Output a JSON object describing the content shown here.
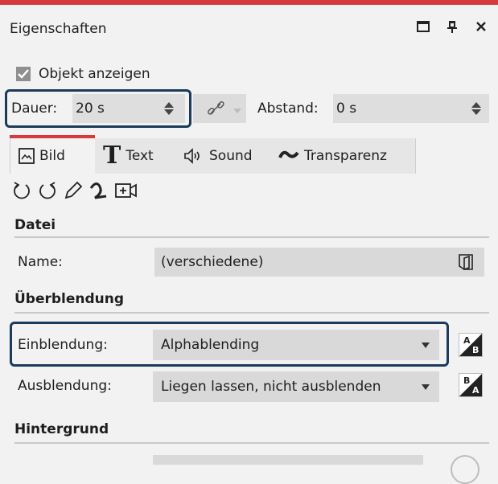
{
  "panel": {
    "title": "Eigenschaften"
  },
  "window_buttons": [
    "maximize-icon",
    "pin-icon",
    "close-icon"
  ],
  "show_object": {
    "label": "Objekt anzeigen",
    "checked": true
  },
  "duration": {
    "label": "Dauer:",
    "value": "20 s"
  },
  "spacing": {
    "label": "Abstand:",
    "value": "0 s"
  },
  "tabs": [
    {
      "label": "Bild",
      "icon": "image-icon",
      "active": true
    },
    {
      "label": "Text",
      "icon": "text-icon",
      "active": false
    },
    {
      "label": "Sound",
      "icon": "speaker-icon",
      "active": false
    },
    {
      "label": "Transparenz",
      "icon": "transparency-icon",
      "active": false
    }
  ],
  "tools": [
    "rotate-left-icon",
    "rotate-right-icon",
    "pen-icon",
    "curve-icon",
    "camera-zoom-icon"
  ],
  "file_section": {
    "title": "Datei",
    "name_label": "Name:",
    "name_value": "(verschiedene)"
  },
  "transition_section": {
    "title": "Überblendung",
    "fade_in_label": "Einblendung:",
    "fade_in_value": "Alphablending",
    "fade_out_label": "Ausblendung:",
    "fade_out_value": "Liegen lassen, nicht ausblenden",
    "ab_button_top": "A",
    "ab_button_bottom": "B",
    "ba_button_top": "B",
    "ba_button_bottom": "A"
  },
  "background_section": {
    "title": "Hintergrund"
  }
}
